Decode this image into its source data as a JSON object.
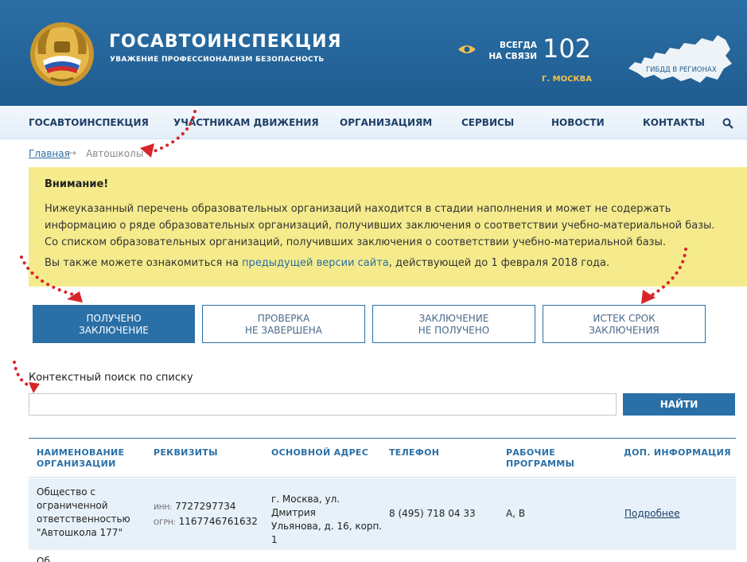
{
  "header": {
    "title": "ГОСАВТОИНСПЕКЦИЯ",
    "subtitle": "УВАЖЕНИЕ ПРОФЕССИОНАЛИЗМ БЕЗОПАСНОСТЬ",
    "always_line1": "ВСЕГДА",
    "always_line2": "НА СВЯЗИ",
    "phone": "102",
    "city": "Г. МОСКВА",
    "map_label": "ГИБДД В РЕГИОНАХ"
  },
  "nav": {
    "items": [
      "ГОСАВТОИНСПЕКЦИЯ",
      "УЧАСТНИКАМ ДВИЖЕНИЯ",
      "ОРГАНИЗАЦИЯМ",
      "СЕРВИСЫ",
      "НОВОСТИ",
      "КОНТАКТЫ"
    ]
  },
  "breadcrumb": {
    "home": "Главная",
    "arrow": "→",
    "current": "Автошколы"
  },
  "notice": {
    "title": "Внимание!",
    "text": "Нижеуказанный перечень образовательных организаций находится в стадии наполнения и может не содержать информацию о ряде образовательных организаций, получивших заключения о соответствии учебно-материальной базы. Со списком образовательных организаций, получивших заключения о соответствии учебно-материальной базы.",
    "line2_before": "Вы также можете ознакомиться на ",
    "line2_link": "предыдущей версии сайта",
    "line2_after": ", действующей до 1 февраля 2018 года."
  },
  "tabs": [
    {
      "line1": "ПОЛУЧЕНО",
      "line2": "ЗАКЛЮЧЕНИЕ"
    },
    {
      "line1": "ПРОВЕРКА",
      "line2": "НЕ ЗАВЕРШЕНА"
    },
    {
      "line1": "ЗАКЛЮЧЕНИЕ",
      "line2": "НЕ ПОЛУЧЕНО"
    },
    {
      "line1": "ИСТЕК СРОК",
      "line2": "ЗАКЛЮЧЕНИЯ"
    }
  ],
  "search": {
    "label": "Контекстный поиск по списку",
    "value": "",
    "button": "НАЙТИ"
  },
  "table": {
    "headers": [
      {
        "line1": "НАИМЕНОВАНИЕ",
        "line2": "ОРГАНИЗАЦИИ"
      },
      {
        "line1": "РЕКВИЗИТЫ",
        "line2": ""
      },
      {
        "line1": "ОСНОВНОЙ АДРЕС",
        "line2": ""
      },
      {
        "line1": "ТЕЛЕФОН",
        "line2": ""
      },
      {
        "line1": "РАБОЧИЕ",
        "line2": "ПРОГРАММЫ"
      },
      {
        "line1": "ДОП. ИНФОРМАЦИЯ",
        "line2": ""
      }
    ],
    "rows": [
      {
        "name_lines": [
          "Общество с",
          "ограниченной",
          "ответственностью",
          "\"Автошкола 177\""
        ],
        "inn_label": "ИНН:",
        "inn": "7727297734",
        "ogrn_label": "ОГРН:",
        "ogrn": "1167746761632",
        "address_lines": [
          "г. Москва, ул. Дмитрия",
          "Ульянова, д. 16, корп.",
          "1"
        ],
        "phone": "8 (495) 718 04 33",
        "programs": "A, B",
        "more": "Подробнее"
      }
    ],
    "next_row_peek": "Об"
  },
  "colors": {
    "brand_blue": "#2a6fa6",
    "notice_yellow": "#f5eb8c",
    "row_highlight": "#e7f1f9",
    "accent_gold": "#f2c14e",
    "annotation_red": "#d9252a"
  },
  "icons": [
    "emblem-icon",
    "eye-icon",
    "russia-map-icon",
    "search-icon"
  ]
}
